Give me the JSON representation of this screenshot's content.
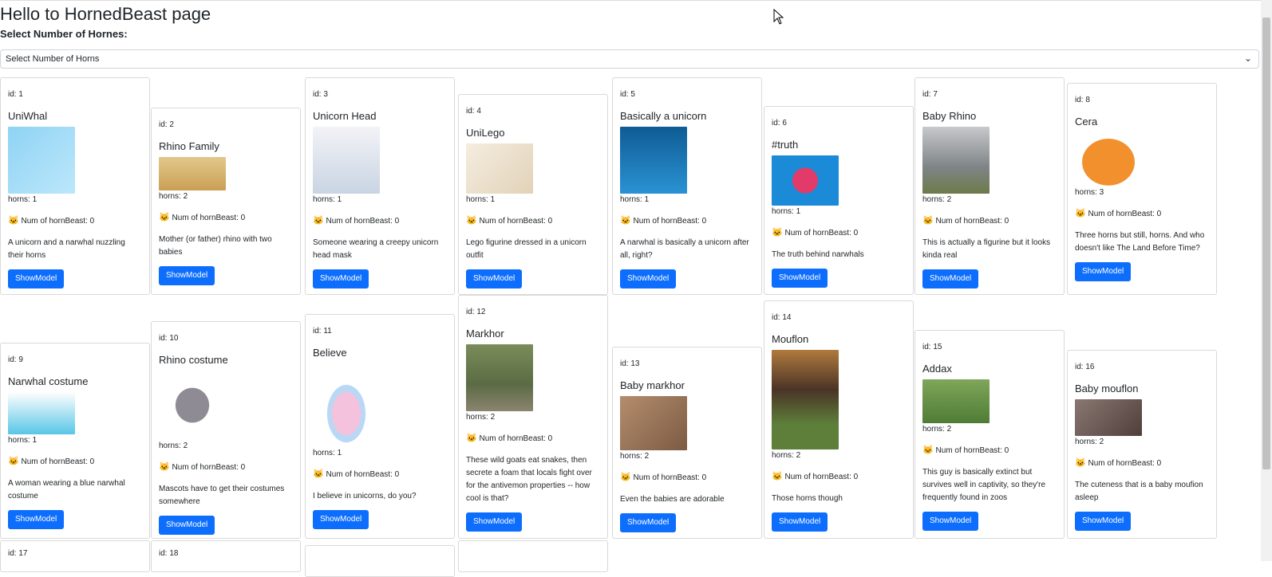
{
  "header": {
    "title": "Hello to HornedBeast page",
    "select_label": "Select Number of Hornes:",
    "select_value": "Select Number of Horns"
  },
  "card_labels": {
    "id_prefix": "id: ",
    "horns_prefix": "horns: ",
    "count_text": "Num of hornBeast: 0",
    "button_label": "ShowModel",
    "count_icon": "cat-face-icon"
  },
  "colors": {
    "button": "#0d6efd"
  },
  "beasts": [
    {
      "id": "1",
      "title": "UniWhal",
      "horns": "1",
      "desc": "A unicorn and a narwhal nuzzling their horns",
      "img_color": "#8fd3f4"
    },
    {
      "id": "2",
      "title": "Rhino Family",
      "horns": "2",
      "desc": "Mother (or father) rhino with two babies",
      "img_color": "#d8b26a"
    },
    {
      "id": "3",
      "title": "Unicorn Head",
      "horns": "1",
      "desc": "Someone wearing a creepy unicorn head mask",
      "img_color": "#e9e9ef"
    },
    {
      "id": "4",
      "title": "UniLego",
      "horns": "1",
      "desc": "Lego figurine dressed in a unicorn outfit",
      "img_color": "#efe2cf"
    },
    {
      "id": "5",
      "title": "Basically a unicorn",
      "horns": "1",
      "desc": "A narwhal is basically a unicorn after all, right?",
      "img_color": "#1f7fc0"
    },
    {
      "id": "6",
      "title": "#truth",
      "horns": "1",
      "desc": "The truth behind narwhals",
      "img_color": "#1b8bd8"
    },
    {
      "id": "7",
      "title": "Baby Rhino",
      "horns": "2",
      "desc": "This is actually a figurine but it looks kinda real",
      "img_color": "#9aa0a3"
    },
    {
      "id": "8",
      "title": "Cera",
      "horns": "3",
      "desc": "Three horns but still, horns. And who doesn't like The Land Before Time?",
      "img_color": "#f2902e"
    },
    {
      "id": "9",
      "title": "Narwhal costume",
      "horns": "1",
      "desc": "A woman wearing a blue narwhal costume",
      "img_color": "#58c6e6"
    },
    {
      "id": "10",
      "title": "Rhino costume",
      "horns": "2",
      "desc": "Mascots have to get their costumes somewhere",
      "img_color": "#8e8b94"
    },
    {
      "id": "11",
      "title": "Believe",
      "horns": "1",
      "desc": "I believe in unicorns, do you?",
      "img_color": "#f4c2dc"
    },
    {
      "id": "12",
      "title": "Markhor",
      "horns": "2",
      "desc": "These wild goats eat snakes, then secrete a foam that locals fight over for the antivemon properties -- how cool is that?",
      "img_color": "#6f7e58"
    },
    {
      "id": "13",
      "title": "Baby markhor",
      "horns": "2",
      "desc": "Even the babies are adorable",
      "img_color": "#a57d5f"
    },
    {
      "id": "14",
      "title": "Mouflon",
      "horns": "2",
      "desc": "Those horns though",
      "img_color": "#5d7f3a"
    },
    {
      "id": "15",
      "title": "Addax",
      "horns": "2",
      "desc": "This guy is basically extinct but survives well in captivity, so they're frequently found in zoos",
      "img_color": "#5e8f45"
    },
    {
      "id": "16",
      "title": "Baby mouflon",
      "horns": "2",
      "desc": "The cuteness that is a baby moufion asleep",
      "img_color": "#6e5a55"
    }
  ],
  "row3_peek": {
    "id_a": "id: 17",
    "id_b": "id: 18"
  }
}
